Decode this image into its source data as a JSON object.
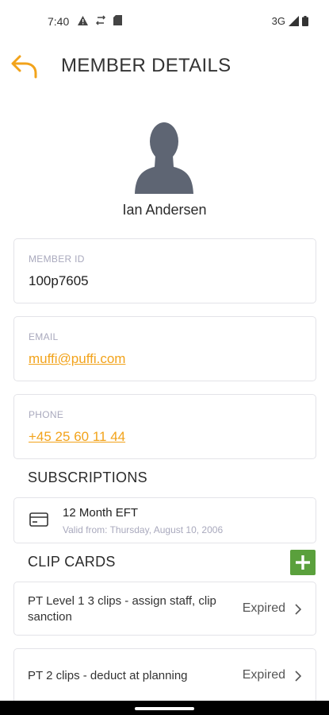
{
  "status_bar": {
    "time": "7:40",
    "icons_left": [
      "warning-icon",
      "sim-sync-icon",
      "sd-card-icon"
    ],
    "network": "3G",
    "icons_right": [
      "signal-icon",
      "battery-icon"
    ]
  },
  "header": {
    "title": "MEMBER DETAILS",
    "back_icon": "back-arrow-icon",
    "accent_color": "#f2a31b"
  },
  "member": {
    "name": "Ian Andersen",
    "avatar_icon": "person-silhouette-icon"
  },
  "fields": {
    "member_id": {
      "label": "MEMBER ID",
      "value": "100p7605"
    },
    "email": {
      "label": "EMAIL",
      "value": "muffi@puffi.com"
    },
    "phone": {
      "label": "PHONE",
      "value": "+45 25 60 11 44"
    }
  },
  "subscriptions": {
    "title": "SUBSCRIPTIONS",
    "items": [
      {
        "name": "12 Month EFT",
        "valid": "Valid from: Thursday, August 10, 2006",
        "icon": "credit-card-icon"
      }
    ]
  },
  "clip_cards": {
    "title": "CLIP CARDS",
    "add_icon": "plus-icon",
    "add_color": "#5aa03c",
    "items": [
      {
        "name": "PT Level 1 3 clips - assign staff, clip sanction",
        "status": "Expired"
      },
      {
        "name": "PT 2 clips - deduct at planning",
        "status": "Expired"
      }
    ]
  }
}
